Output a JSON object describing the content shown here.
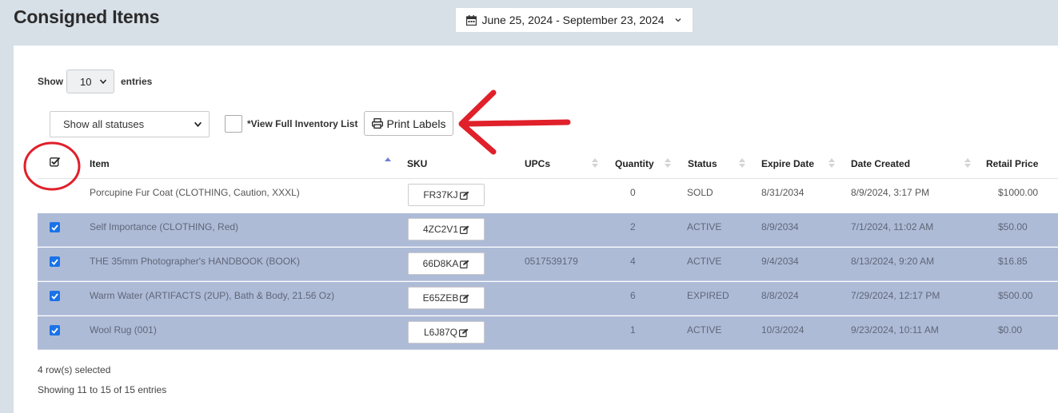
{
  "page": {
    "title": "Consigned Items"
  },
  "date_range": {
    "label": "June 25, 2024 - September 23, 2024"
  },
  "controls": {
    "show_label": "Show",
    "entries_value": "10",
    "entries_label": "entries",
    "status_filter": "Show all statuses",
    "full_inventory_label": "*View Full Inventory List",
    "print_labels": "Print Labels"
  },
  "table": {
    "headers": {
      "item": "Item",
      "sku": "SKU",
      "upcs": "UPCs",
      "quantity": "Quantity",
      "status": "Status",
      "expire_date": "Expire Date",
      "date_created": "Date Created",
      "retail_price": "Retail Price"
    },
    "rows": [
      {
        "selected": false,
        "item": "Porcupine Fur Coat (CLOTHING, Caution, XXXL)",
        "sku": "FR37KJ",
        "upc": "",
        "quantity": "0",
        "status": "SOLD",
        "expire": "8/31/2034",
        "created": "8/9/2024, 3:17 PM",
        "price": "$1000.00"
      },
      {
        "selected": true,
        "item": "Self Importance (CLOTHING, Red)",
        "sku": "4ZC2V1",
        "upc": "",
        "quantity": "2",
        "status": "ACTIVE",
        "expire": "8/9/2034",
        "created": "7/1/2024, 11:02 AM",
        "price": "$50.00"
      },
      {
        "selected": true,
        "item": "THE 35mm Photographer's HANDBOOK (BOOK)",
        "sku": "66D8KA",
        "upc": "0517539179",
        "quantity": "4",
        "status": "ACTIVE",
        "expire": "9/4/2034",
        "created": "8/13/2024, 9:20 AM",
        "price": "$16.85"
      },
      {
        "selected": true,
        "item": "Warm Water (ARTIFACTS (2UP), Bath & Body, 21.56 Oz)",
        "sku": "E65ZEB",
        "upc": "",
        "quantity": "6",
        "status": "EXPIRED",
        "expire": "8/8/2024",
        "created": "7/29/2024, 12:17 PM",
        "price": "$500.00"
      },
      {
        "selected": true,
        "item": "Wool Rug (001)",
        "sku": "L6J87Q",
        "upc": "",
        "quantity": "1",
        "status": "ACTIVE",
        "expire": "10/3/2024",
        "created": "9/23/2024, 10:11 AM",
        "price": "$0.00"
      }
    ]
  },
  "footer": {
    "selected_text": "4 row(s) selected",
    "showing_text": "Showing 11 to 15 of 15 entries"
  },
  "icons": {
    "calendar": "calendar-icon",
    "chevron": "chevron-down-icon",
    "print": "printer-icon",
    "edit": "edit-icon",
    "checkbox": "checkbox-checked-icon",
    "sort": "sort-icon"
  },
  "colors": {
    "page_bg": "#d7dfe7",
    "selected_row": "#aebbd7",
    "checkbox_blue": "#1a73e8",
    "annotation_red": "#e0202a"
  }
}
